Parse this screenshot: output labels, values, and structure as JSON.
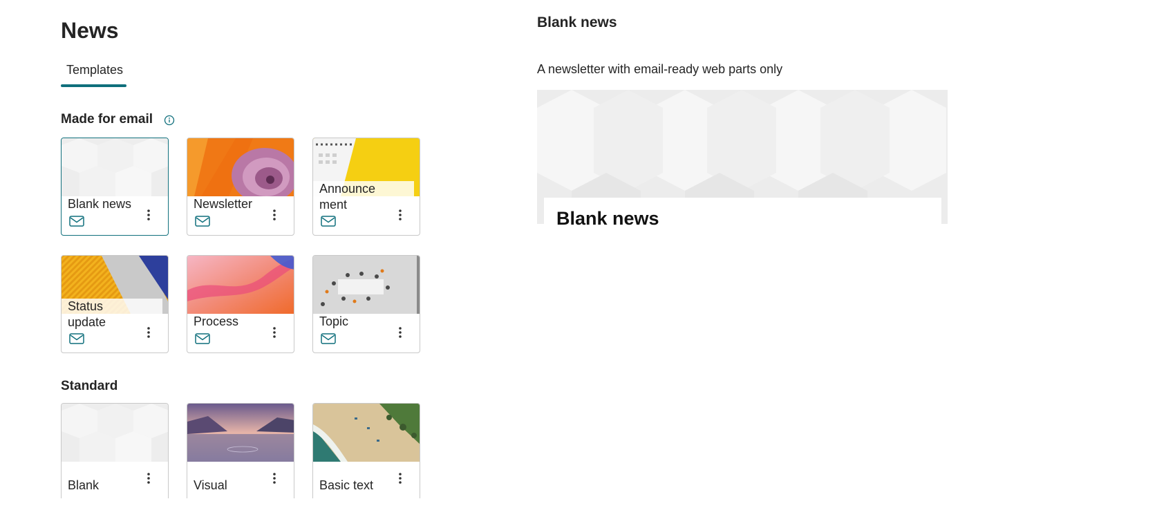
{
  "page": {
    "title": "News"
  },
  "tabs": [
    {
      "label": "Templates",
      "selected": true
    }
  ],
  "sections": {
    "email": {
      "title": "Made for email",
      "info_icon": "info-icon"
    },
    "standard": {
      "title": "Standard"
    }
  },
  "email_templates": [
    {
      "label": "Blank news",
      "thumbnail": "white-geometric-pattern",
      "icon": "mail-icon",
      "selected": true
    },
    {
      "label": "Newsletter",
      "thumbnail": "nautilus-shell-orange",
      "icon": "mail-icon"
    },
    {
      "label": "Announce\nment",
      "thumbnail": "notebook-yellow",
      "icon": "mail-icon"
    },
    {
      "label": "Status\nupdate",
      "thumbnail": "orange-stripes-blue",
      "icon": "mail-icon"
    },
    {
      "label": "Process",
      "thumbnail": "pink-orange-wave",
      "icon": "mail-icon"
    },
    {
      "label": "Topic",
      "thumbnail": "office-aerial-view",
      "icon": "mail-icon"
    }
  ],
  "standard_templates": [
    {
      "label": "Blank",
      "thumbnail": "white-geometric-pattern"
    },
    {
      "label": "Visual",
      "thumbnail": "misty-lake"
    },
    {
      "label": "Basic text",
      "thumbnail": "beach-aerial"
    }
  ],
  "more_options_icon": "more-vertical-icon",
  "preview": {
    "heading": "Blank news",
    "description": "A newsletter with email-ready web parts only",
    "card_title": "Blank news"
  },
  "colors": {
    "accent": "#0f6f7c",
    "border": "#c8c8c8",
    "text": "#242424"
  }
}
